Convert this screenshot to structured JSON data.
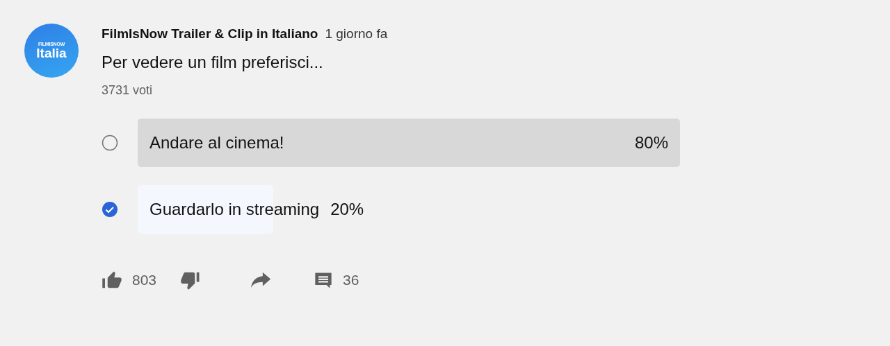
{
  "avatar": {
    "line_1": "FILMISNOW",
    "line_2": "Italia"
  },
  "channel": "FilmIsNow Trailer & Clip in Italiano",
  "time": "1 giorno fa",
  "question": "Per vedere un film preferisci...",
  "votes": "3731 voti",
  "options": [
    {
      "label": "Andare al cinema!",
      "percent": "80%",
      "selected": false,
      "level": 1
    },
    {
      "label": "Guardarlo in streaming",
      "percent": "20%",
      "selected": true,
      "level": 0.25
    }
  ],
  "actions": {
    "likes": "803",
    "comments": "36"
  }
}
